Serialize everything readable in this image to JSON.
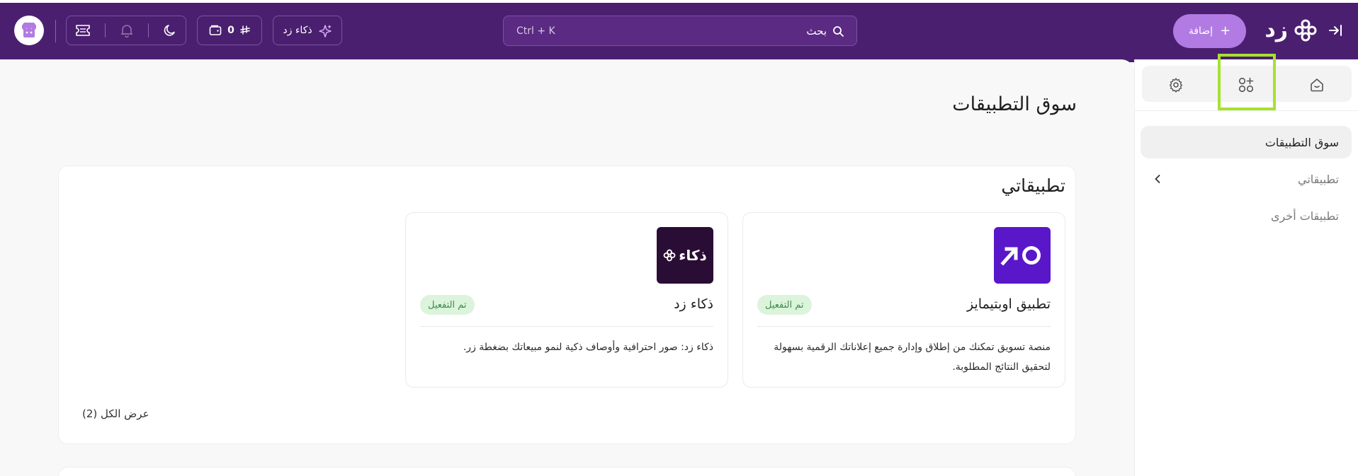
{
  "topbar": {
    "brand_name": "زد",
    "add_label": "إضافة",
    "search_label": "بحث",
    "search_shortcut": "Ctrl + K",
    "ai_label": "ذكاء زد",
    "wallet_value": "0"
  },
  "sidebar": {
    "tabs": [
      {
        "icon": "home-icon"
      },
      {
        "icon": "apps-add-icon"
      },
      {
        "icon": "gear-icon"
      }
    ],
    "items": [
      {
        "label": "سوق التطبيقات"
      },
      {
        "label": "تطبيقاتي"
      },
      {
        "label": "تطبيقات أخرى"
      }
    ]
  },
  "main": {
    "page_title": "سوق التطبيقات",
    "section_title": "تطبيقاتي",
    "apps": [
      {
        "name": "تطبيق اوبتيمايز",
        "badge": "تم التفعيل",
        "description": "منصة تسويق تمكنك من إطلاق وإدارة جميع إعلاناتك الرقمية بسهولة لتحقيق النتائج المطلوبة."
      },
      {
        "name": "ذكاء زد",
        "logo_text": "ذكاء",
        "badge": "تم التفعيل",
        "description": "ذكاء زد: صور احترافية وأوصاف ذكية لنمو مبيعاتك بضغطة زر."
      }
    ],
    "view_all": "عرض الكل (2)"
  },
  "colors": {
    "topbar_bg": "#4b1f6f",
    "accent": "#b17be3",
    "badge_bg": "#dcf3dc",
    "badge_text": "#3c8f48",
    "highlight": "#a6e22e"
  }
}
